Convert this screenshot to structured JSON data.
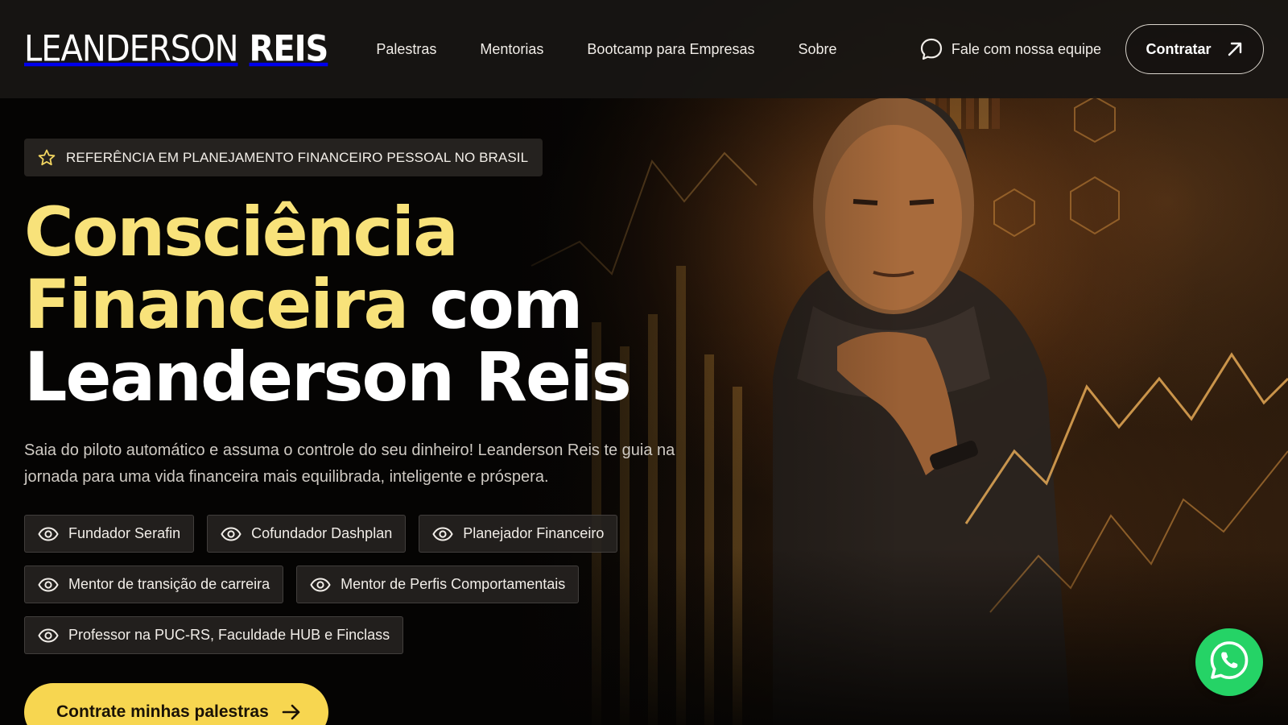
{
  "header": {
    "logo_first": "LEANDERSON",
    "logo_last": "REIS",
    "nav": [
      {
        "label": "Palestras"
      },
      {
        "label": "Mentorias"
      },
      {
        "label": "Bootcamp para Empresas"
      },
      {
        "label": "Sobre"
      }
    ],
    "chat_label": "Fale com nossa equipe",
    "chat_icon": "chat-bubble-icon",
    "contratar_label": "Contratar",
    "contratar_icon": "arrow-up-right-icon"
  },
  "hero": {
    "badge": "REFERÊNCIA EM PLANEJAMENTO FINANCEIRO PESSOAL NO BRASIL",
    "badge_icon": "star-icon",
    "headline_yellow_1": "Consciência",
    "headline_yellow_2": "Financeira",
    "headline_white_2": "com",
    "headline_white_3": "Leanderson Reis",
    "subtitle": "Saia do piloto automático e assuma o controle do seu dinheiro! Leanderson Reis te guia na jornada para uma vida financeira mais equilibrada, inteligente e próspera.",
    "roles": [
      {
        "label": "Fundador Serafin"
      },
      {
        "label": "Cofundador Dashplan"
      },
      {
        "label": "Planejador Financeiro"
      },
      {
        "label": "Mentor de transição de carreira"
      },
      {
        "label": "Mentor de Perfis Comportamentais"
      },
      {
        "label": "Professor na PUC-RS, Faculdade HUB e Finclass"
      }
    ],
    "role_icon": "eye-icon",
    "cta_label": "Contrate minhas palestras",
    "cta_icon": "arrow-right-icon"
  },
  "floating": {
    "whatsapp_icon": "whatsapp-icon"
  },
  "colors": {
    "accent_yellow": "#f8e27a",
    "cta_yellow": "#f7d650",
    "whatsapp_green": "#25d366",
    "header_bg": "#181614"
  }
}
